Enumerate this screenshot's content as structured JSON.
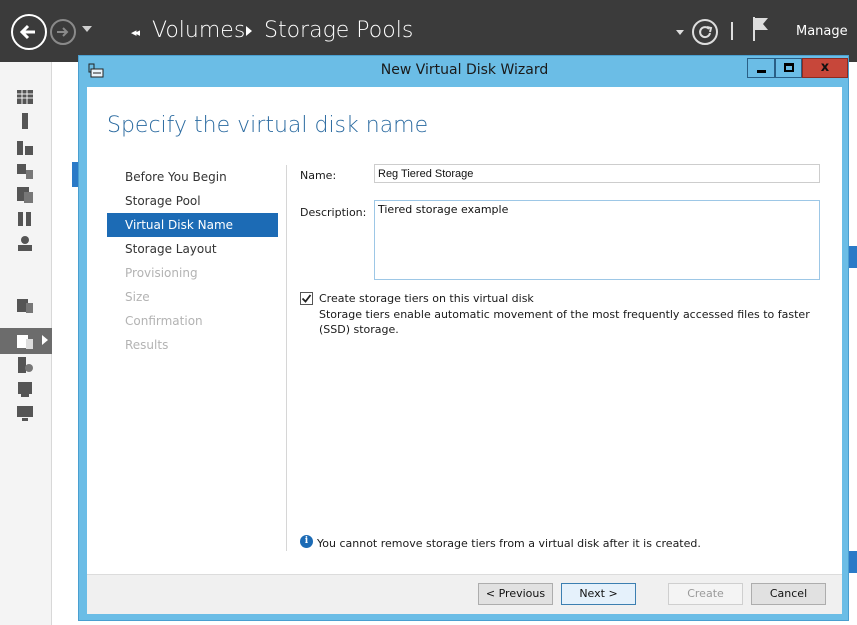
{
  "server_manager": {
    "breadcrumb": [
      "Volumes",
      "Storage Pools"
    ],
    "manage_label": "Manage"
  },
  "dialog": {
    "title": "New Virtual Disk Wizard",
    "close_glyph": "x",
    "heading": "Specify the virtual disk name",
    "steps": [
      {
        "label": "Before You Begin",
        "state": "done"
      },
      {
        "label": "Storage Pool",
        "state": "done"
      },
      {
        "label": "Virtual Disk Name",
        "state": "active"
      },
      {
        "label": "Storage Layout",
        "state": "pending"
      },
      {
        "label": "Provisioning",
        "state": "disabled"
      },
      {
        "label": "Size",
        "state": "disabled"
      },
      {
        "label": "Confirmation",
        "state": "disabled"
      },
      {
        "label": "Results",
        "state": "disabled"
      }
    ],
    "form": {
      "name_label": "Name:",
      "name_value": "Reg Tiered Storage",
      "description_label": "Description:",
      "description_value": "Tiered storage example",
      "tiers_checkbox_label": "Create storage tiers on this virtual disk",
      "tiers_checked": true,
      "tiers_description": "Storage tiers enable automatic movement of the most frequently accessed files to faster (SSD) storage."
    },
    "info_message": "You cannot remove storage tiers from a virtual disk after it is created.",
    "buttons": {
      "previous": "< Previous",
      "next": "Next >",
      "create": "Create",
      "cancel": "Cancel"
    }
  },
  "colors": {
    "accent": "#1c6bb5",
    "dialog_frame": "#6bbde6",
    "topbar": "#3b3b3b"
  }
}
